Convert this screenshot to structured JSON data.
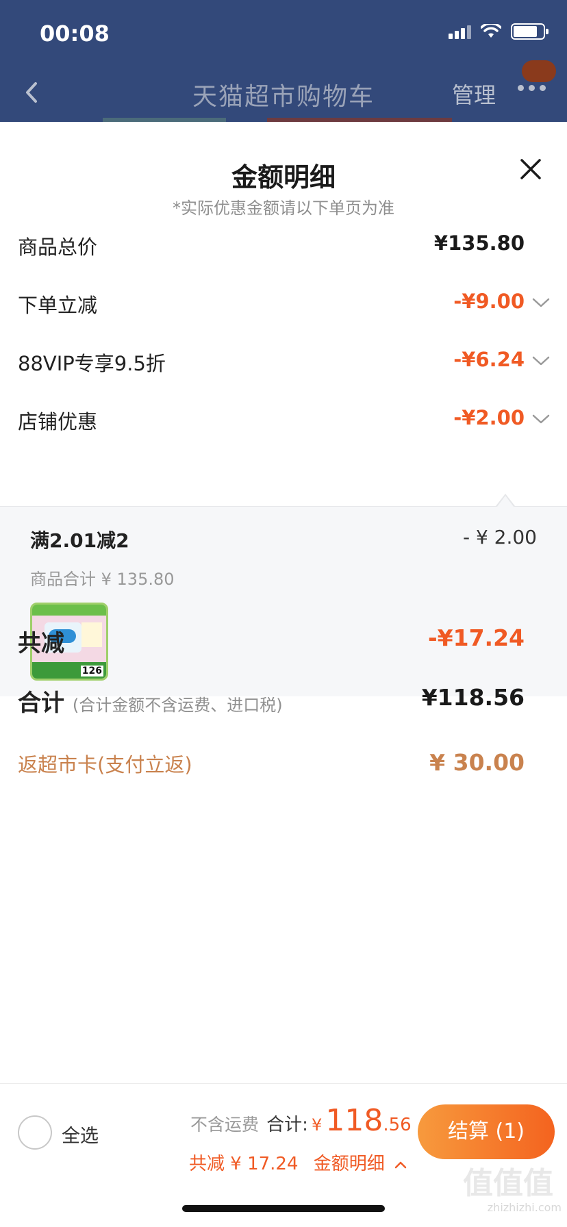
{
  "status": {
    "time": "00:08"
  },
  "nav": {
    "title": "天猫超市购物车",
    "manage": "管理"
  },
  "sheet": {
    "title": "金额明细",
    "subtitle": "*实际优惠金额请以下单页为准",
    "rows": [
      {
        "label": "商品总价",
        "value": "¥135.80"
      },
      {
        "label": "下单立减",
        "value": "-¥9.00"
      },
      {
        "label": "88VIP专享9.5折",
        "value": "-¥6.24"
      },
      {
        "label": "店铺优惠",
        "value": "-¥2.00"
      }
    ],
    "discount_panel": {
      "title": "满2.01减2",
      "value": "- ¥ 2.00",
      "subtotal": "商品合计 ¥ 135.80",
      "product_price": "126"
    },
    "total_discount": {
      "label": "共减",
      "value": "-¥17.24"
    },
    "grand_total": {
      "label": "合计",
      "note": "(合计金额不含运费、进口税)",
      "value": "¥118.56"
    },
    "rebate": {
      "label": "返超市卡(支付立返)",
      "value": "¥ 30.00"
    }
  },
  "bottom_bar": {
    "select_all": "全选",
    "shipping_note": "不含运费",
    "sum_label": "合计:",
    "currency": "¥",
    "amount_int": "118",
    "amount_dec": ".56",
    "discount_text": "共减 ¥ 17.24",
    "detail_link": "金额明细",
    "checkout": "结算 (1)"
  },
  "watermark": {
    "main": "值值值",
    "sub": "zhizhizhi.com"
  },
  "colors": {
    "accent": "#f05a24",
    "rebate": "#c9824e",
    "nav_bg": "#33497a"
  }
}
